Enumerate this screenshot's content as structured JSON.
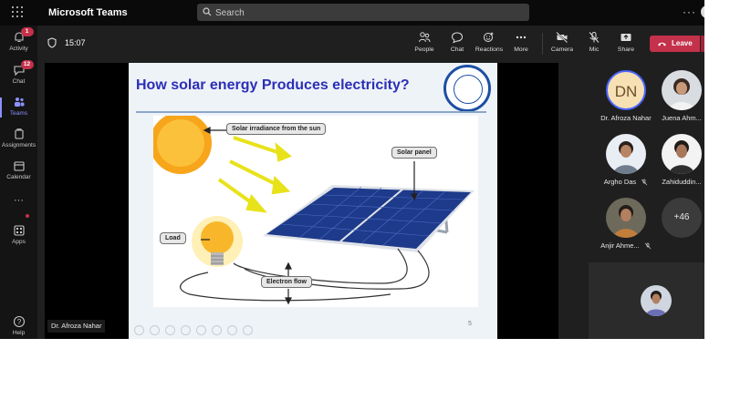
{
  "app": {
    "title": "Microsoft Teams"
  },
  "search": {
    "placeholder": "Search"
  },
  "rail": {
    "items": [
      {
        "label": "Activity",
        "badge": "1",
        "icon": "bell-icon"
      },
      {
        "label": "Chat",
        "badge": "12",
        "icon": "chat-icon"
      },
      {
        "label": "Teams",
        "icon": "teams-icon",
        "active": true
      },
      {
        "label": "Assignments",
        "icon": "assignments-icon"
      },
      {
        "label": "Calendar",
        "icon": "calendar-icon"
      },
      {
        "label": "Apps",
        "icon": "apps-icon"
      },
      {
        "label": "Help",
        "icon": "help-icon"
      }
    ]
  },
  "meeting": {
    "timer": "15:07",
    "controls": [
      {
        "label": "People",
        "icon": "people-icon"
      },
      {
        "label": "Chat",
        "icon": "chat-bubble-icon"
      },
      {
        "label": "Reactions",
        "icon": "reactions-icon"
      },
      {
        "label": "More",
        "icon": "more-icon"
      },
      {
        "label": "Camera",
        "icon": "camera-off-icon"
      },
      {
        "label": "Mic",
        "icon": "mic-off-icon"
      },
      {
        "label": "Share",
        "icon": "share-icon"
      }
    ],
    "leave_label": "Leave",
    "leave_color": "#c4314b"
  },
  "slide": {
    "title": "How solar energy Produces electricity?",
    "labels": {
      "irradiance": "Solar irradiance from the sun",
      "panel": "Solar panel",
      "load": "Load",
      "flow": "Electron flow"
    },
    "page_number": "5"
  },
  "presenter": {
    "name": "Dr. Afroza Nahar"
  },
  "participants": [
    {
      "name": "Dr. Afroza Nahar",
      "initials": "DN",
      "muted": false
    },
    {
      "name": "Juena Ahm...",
      "muted": false
    },
    {
      "name": "Argho Das",
      "muted": true
    },
    {
      "name": "Zahiduddin...",
      "muted": false
    },
    {
      "name": "Anjir Ahme...",
      "muted": true
    },
    {
      "name": "",
      "more_count": "+46"
    }
  ],
  "colors": {
    "accent": "#8b91ff",
    "badge": "#c4314b",
    "slide_title": "#2b2fb6"
  }
}
